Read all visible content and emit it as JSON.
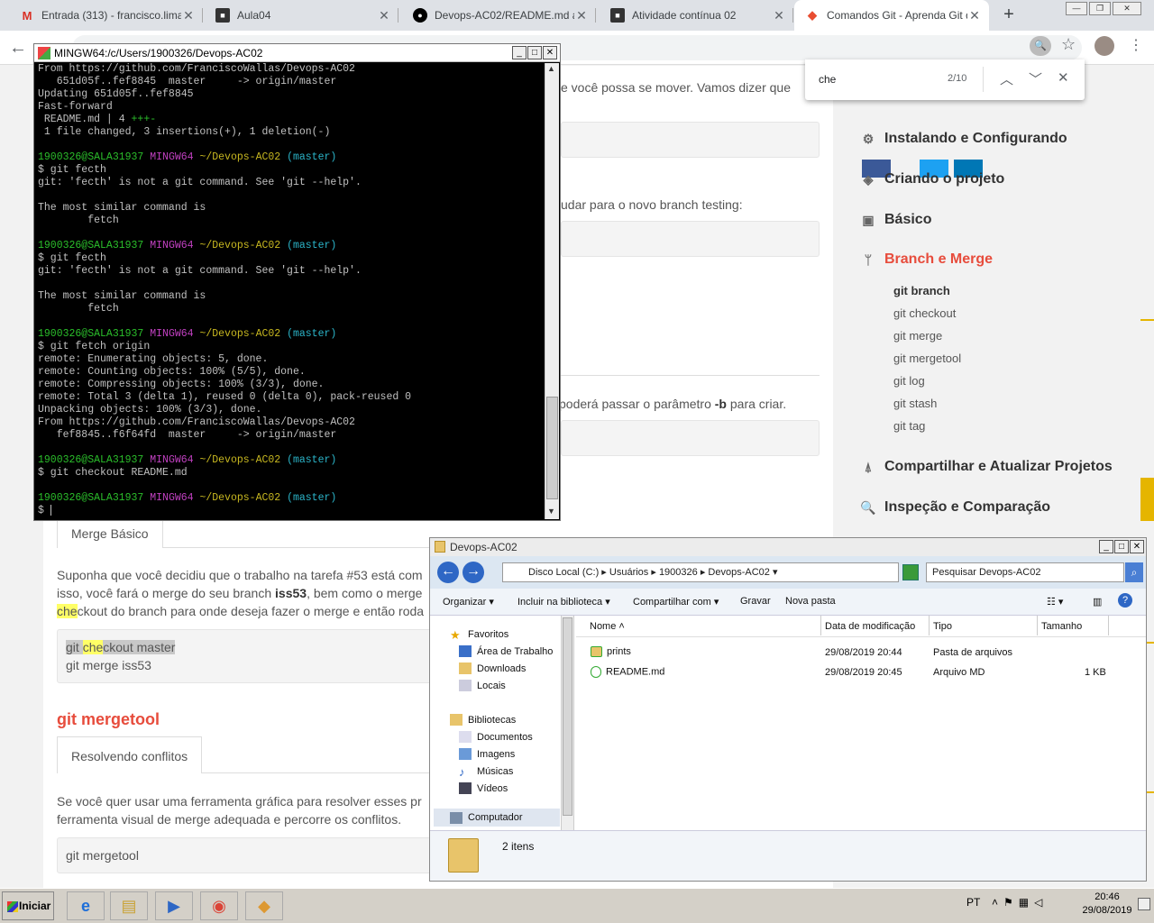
{
  "browser": {
    "tabs": [
      {
        "title": "Entrada (313) - francisco.lima@",
        "icon": "gmail-icon"
      },
      {
        "title": "Aula04",
        "icon": "classroom-icon"
      },
      {
        "title": "Devops-AC02/README.md at m",
        "icon": "github-icon"
      },
      {
        "title": "Atividade contínua 02",
        "icon": "classroom-icon"
      },
      {
        "title": "Comandos Git - Aprenda Git do",
        "icon": "git-icon"
      }
    ],
    "new_tab": "+",
    "find": {
      "query": "che",
      "count": "2/10"
    }
  },
  "terminal": {
    "title": "MINGW64:/c/Users/1900326/Devops-AC02",
    "lines": [
      [
        [
          "From https://github.com/FranciscoWallas/Devops-AC02",
          ""
        ]
      ],
      [
        [
          "   651d05f..fef8845  master     -> origin/master",
          ""
        ]
      ],
      [
        [
          "Updating 651d05f..fef8845",
          ""
        ]
      ],
      [
        [
          "Fast-forward",
          ""
        ]
      ],
      [
        [
          " README.md | 4 ",
          ""
        ],
        [
          "+++-",
          "g"
        ]
      ],
      [
        [
          " 1 file changed, 3 insertions(+), 1 deletion(-)",
          ""
        ]
      ],
      [
        [
          "",
          ""
        ]
      ],
      [
        [
          "1900326@SALA31937 ",
          "g"
        ],
        [
          "MINGW64 ",
          "m"
        ],
        [
          "~/Devops-AC02 ",
          "y"
        ],
        [
          "(master)",
          "c"
        ]
      ],
      [
        [
          "$ git fecth",
          ""
        ]
      ],
      [
        [
          "git: 'fecth' is not a git command. See 'git --help'.",
          ""
        ]
      ],
      [
        [
          "",
          ""
        ]
      ],
      [
        [
          "The most similar command is",
          ""
        ]
      ],
      [
        [
          "        fetch",
          ""
        ]
      ],
      [
        [
          "",
          ""
        ]
      ],
      [
        [
          "1900326@SALA31937 ",
          "g"
        ],
        [
          "MINGW64 ",
          "m"
        ],
        [
          "~/Devops-AC02 ",
          "y"
        ],
        [
          "(master)",
          "c"
        ]
      ],
      [
        [
          "$ git fecth",
          ""
        ]
      ],
      [
        [
          "git: 'fecth' is not a git command. See 'git --help'.",
          ""
        ]
      ],
      [
        [
          "",
          ""
        ]
      ],
      [
        [
          "The most similar command is",
          ""
        ]
      ],
      [
        [
          "        fetch",
          ""
        ]
      ],
      [
        [
          "",
          ""
        ]
      ],
      [
        [
          "1900326@SALA31937 ",
          "g"
        ],
        [
          "MINGW64 ",
          "m"
        ],
        [
          "~/Devops-AC02 ",
          "y"
        ],
        [
          "(master)",
          "c"
        ]
      ],
      [
        [
          "$ git fetch origin",
          ""
        ]
      ],
      [
        [
          "remote: Enumerating objects: 5, done.",
          ""
        ]
      ],
      [
        [
          "remote: Counting objects: 100% (5/5), done.",
          ""
        ]
      ],
      [
        [
          "remote: Compressing objects: 100% (3/3), done.",
          ""
        ]
      ],
      [
        [
          "remote: Total 3 (delta 1), reused 0 (delta 0), pack-reused 0",
          ""
        ]
      ],
      [
        [
          "Unpacking objects: 100% (3/3), done.",
          ""
        ]
      ],
      [
        [
          "From https://github.com/FranciscoWallas/Devops-AC02",
          ""
        ]
      ],
      [
        [
          "   fef8845..f6f64fd  master     -> origin/master",
          ""
        ]
      ],
      [
        [
          "",
          ""
        ]
      ],
      [
        [
          "1900326@SALA31937 ",
          "g"
        ],
        [
          "MINGW64 ",
          "m"
        ],
        [
          "~/Devops-AC02 ",
          "y"
        ],
        [
          "(master)",
          "c"
        ]
      ],
      [
        [
          "$ git checkout README.md",
          ""
        ]
      ],
      [
        [
          "",
          ""
        ]
      ],
      [
        [
          "1900326@SALA31937 ",
          "g"
        ],
        [
          "MINGW64 ",
          "m"
        ],
        [
          "~/Devops-AC02 ",
          "y"
        ],
        [
          "(master)",
          "c"
        ]
      ],
      [
        [
          "$ ",
          ""
        ]
      ]
    ]
  },
  "article": {
    "p1_tail": "e você possa se mover. Vamos dizer que",
    "p2_tail": "udar para o novo branch testing:",
    "p3_tail_a": "poderá passar o parâmetro ",
    "p3_tail_b": "-b",
    "p3_tail_c": " para criar.",
    "merge_tab": "Merge Básico",
    "merge_p1": "Suponha que você decidiu que o trabalho na tarefa #53 está com",
    "merge_p2_a": "isso, você fará o merge do seu branch ",
    "merge_p2_b": "iss53",
    "merge_p2_c": ", bem como o merge",
    "merge_p3_a": "che",
    "merge_p3_b": "ckout do branch para onde deseja fazer o merge e então roda",
    "code1_a": "git ",
    "code1_b": "che",
    "code1_c": "ckout master",
    "code1_line2": "git merge iss53",
    "mergetool_heading": "git mergetool",
    "mergetool_tab": "Resolvendo conflitos",
    "mergetool_p1": "Se você quer usar uma ferramenta gráfica para resolver esses pr",
    "mergetool_p2": "ferramenta visual de merge adequada e percorre os conflitos.",
    "code2": "git mergetool"
  },
  "sidebar": {
    "sections": [
      {
        "label": "Instalando e Configurando",
        "icon": "gear-icon"
      },
      {
        "label": "Criando o projeto",
        "icon": "box-icon"
      },
      {
        "label": "Básico",
        "icon": "camera-icon"
      },
      {
        "label": "Branch e Merge",
        "icon": "branch-icon"
      },
      {
        "label": "Compartilhar e Atualizar Projetos",
        "icon": "antenna-icon"
      },
      {
        "label": "Inspeção e Comparação",
        "icon": "search-icon"
      }
    ],
    "sub": [
      "git branch",
      "git checkout",
      "git merge",
      "git mergetool",
      "git log",
      "git stash",
      "git tag"
    ]
  },
  "explorer": {
    "title": "Devops-AC02",
    "breadcrumb": [
      "Disco Local (C:)",
      "Usuários",
      "1900326",
      "Devops-AC02"
    ],
    "search_placeholder": "Pesquisar Devops-AC02",
    "commands": [
      "Organizar",
      "Incluir na biblioteca",
      "Compartilhar com",
      "Gravar",
      "Nova pasta"
    ],
    "nav": {
      "favorites": "Favoritos",
      "fav_items": [
        "Área de Trabalho",
        "Downloads",
        "Locais"
      ],
      "libraries": "Bibliotecas",
      "lib_items": [
        "Documentos",
        "Imagens",
        "Músicas",
        "Vídeos"
      ],
      "computer": "Computador"
    },
    "columns": [
      "Nome",
      "Data de modificação",
      "Tipo",
      "Tamanho"
    ],
    "files": [
      {
        "name": "prints",
        "date": "29/08/2019 20:44",
        "type": "Pasta de arquivos",
        "size": ""
      },
      {
        "name": "README.md",
        "date": "29/08/2019 20:45",
        "type": "Arquivo MD",
        "size": "1 KB"
      }
    ],
    "status": "2 itens"
  },
  "taskbar": {
    "start": "Iniciar",
    "lang": "PT",
    "time": "20:46",
    "date": "29/08/2019"
  }
}
